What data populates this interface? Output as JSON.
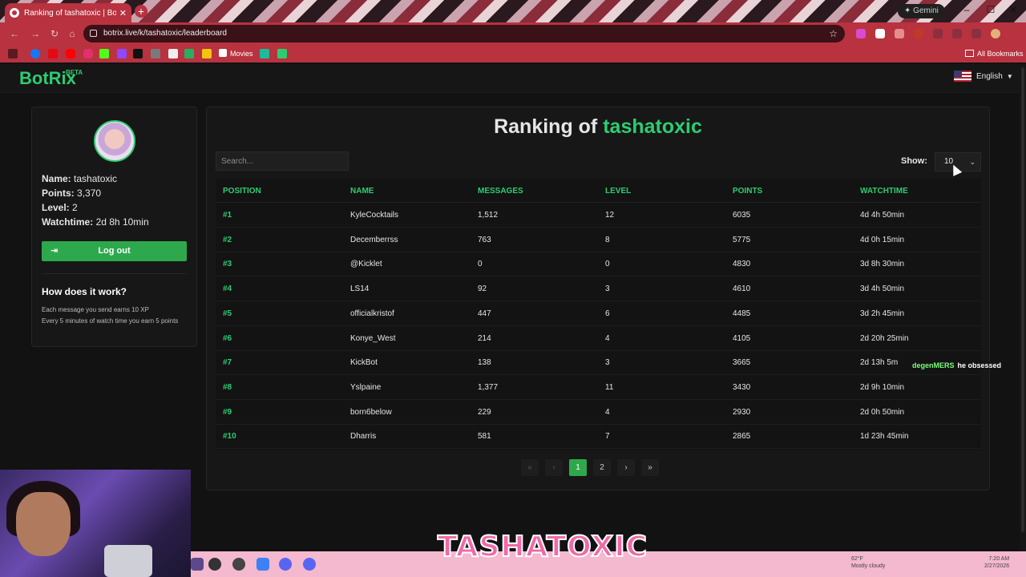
{
  "browser": {
    "tab_title": "Ranking of tashatoxic | BotRix",
    "url": "botrix.live/k/tashatoxic/leaderboard",
    "gemini_label": "Gemini",
    "bookmark_movies": "Movies",
    "all_bookmarks": "All Bookmarks"
  },
  "site": {
    "logo": "BotRix",
    "logo_badge": "BETA",
    "language": "English"
  },
  "profile": {
    "name_label": "Name:",
    "name": "tashatoxic",
    "points_label": "Points:",
    "points": "3,370",
    "level_label": "Level:",
    "level": "2",
    "watchtime_label": "Watchtime:",
    "watchtime": "2d 8h 10min",
    "logout": "Log out",
    "how_title": "How does it work?",
    "how_line1": "Each message you send earns 10 XP",
    "how_line2": "Every 5 minutes of watch time you earn 5 points"
  },
  "leaderboard": {
    "title_prefix": "Ranking of",
    "title_user": "tashatoxic",
    "search_placeholder": "Search...",
    "show_label": "Show:",
    "show_value": "10",
    "columns": [
      "Position",
      "Name",
      "Messages",
      "Level",
      "Points",
      "Watchtime"
    ],
    "rows": [
      {
        "position": "#1",
        "name": "KyleCocktails",
        "messages": "1,512",
        "level": "12",
        "points": "6035",
        "watchtime": "4d 4h 50min"
      },
      {
        "position": "#2",
        "name": "Decemberrss",
        "messages": "763",
        "level": "8",
        "points": "5775",
        "watchtime": "4d 0h 15min"
      },
      {
        "position": "#3",
        "name": "@Kicklet",
        "messages": "0",
        "level": "0",
        "points": "4830",
        "watchtime": "3d 8h 30min"
      },
      {
        "position": "#4",
        "name": "LS14",
        "messages": "92",
        "level": "3",
        "points": "4610",
        "watchtime": "3d 4h 50min"
      },
      {
        "position": "#5",
        "name": "officialkristof",
        "messages": "447",
        "level": "6",
        "points": "4485",
        "watchtime": "3d 2h 45min"
      },
      {
        "position": "#6",
        "name": "Konye_West",
        "messages": "214",
        "level": "4",
        "points": "4105",
        "watchtime": "2d 20h 25min"
      },
      {
        "position": "#7",
        "name": "KickBot",
        "messages": "138",
        "level": "3",
        "points": "3665",
        "watchtime": "2d 13h 5m"
      },
      {
        "position": "#8",
        "name": "Yslpaine",
        "messages": "1,377",
        "level": "11",
        "points": "3430",
        "watchtime": "2d 9h 10min"
      },
      {
        "position": "#9",
        "name": "born6below",
        "messages": "229",
        "level": "4",
        "points": "2930",
        "watchtime": "2d 0h 50min"
      },
      {
        "position": "#10",
        "name": "Dharris",
        "messages": "581",
        "level": "7",
        "points": "2865",
        "watchtime": "1d 23h 45min"
      }
    ],
    "pages": [
      "1",
      "2"
    ],
    "current_page": "1"
  },
  "chat_overlay": {
    "name": "degenMERS",
    "message": "he obsessed"
  },
  "stream_banner": "TASHATOXIC",
  "taskbar": {
    "weather_temp": "62°F",
    "weather_desc": "Mostly cloudy",
    "time": "7:20 AM",
    "date": "2/27/2026"
  },
  "colors": {
    "accent": "#2ecc71",
    "browser_red": "#b8323f",
    "background": "#121212",
    "card": "#171717"
  }
}
